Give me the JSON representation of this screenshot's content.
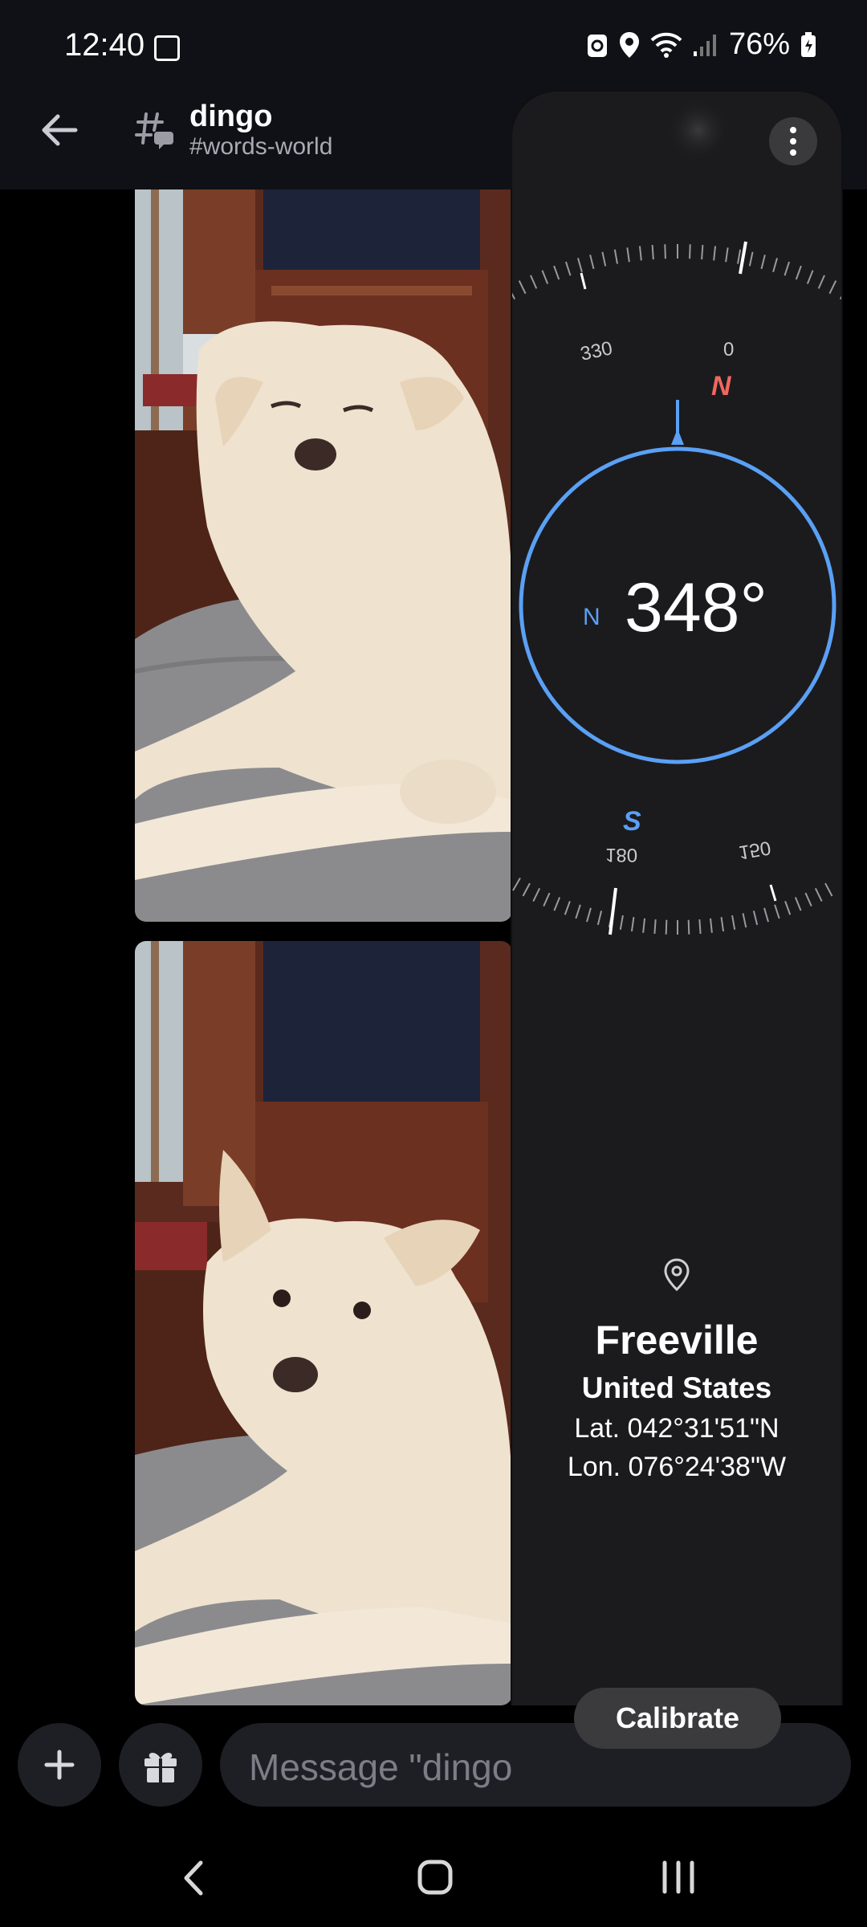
{
  "status_bar": {
    "time": "12:40",
    "battery": "76%"
  },
  "header": {
    "channel_name": "dingo",
    "channel_sub": "#words-world"
  },
  "composer": {
    "placeholder": "Message \"dingo"
  },
  "compass": {
    "heading": "348°",
    "inner_north_label": "N",
    "cardinal_north": "N",
    "cardinal_south": "S",
    "tick_labels": {
      "t330": "330",
      "t0": "0",
      "t180": "180",
      "t150": "150"
    },
    "colors": {
      "ring": "#5aa0f5",
      "north": "#f0675f",
      "south": "#5aa0f5"
    }
  },
  "location": {
    "city": "Freeville",
    "country": "United States",
    "lat": "Lat. 042°31'51\"N",
    "lon": "Lon. 076°24'38\"W"
  },
  "calibrate_label": "Calibrate"
}
